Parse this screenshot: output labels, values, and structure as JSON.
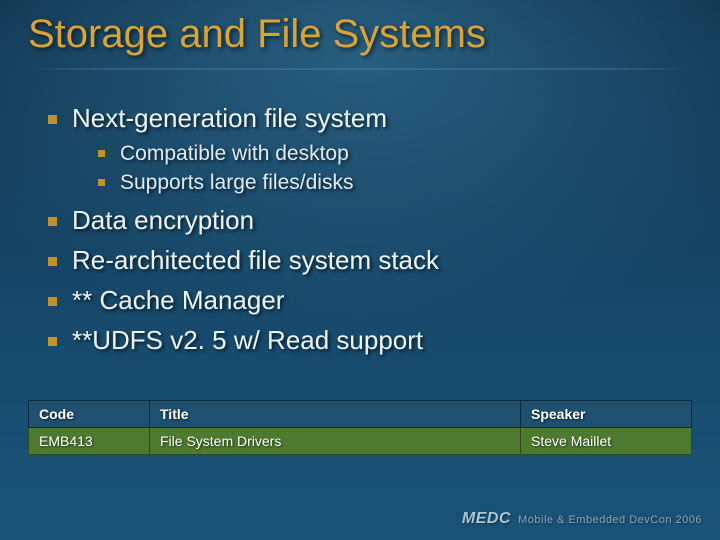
{
  "title": "Storage and File Systems",
  "bullets": {
    "level1": [
      "Next-generation file system",
      "Data encryption",
      "Re-architected file system stack",
      "** Cache Manager",
      "**UDFS v2. 5 w/ Read support"
    ],
    "level2_under_0": [
      "Compatible with desktop",
      "Supports large files/disks"
    ]
  },
  "table": {
    "headers": {
      "code": "Code",
      "title": "Title",
      "speaker": "Speaker"
    },
    "rows": [
      {
        "code": "EMB413",
        "title": "File System Drivers",
        "speaker": "Steve Maillet"
      }
    ]
  },
  "footer": {
    "brand": "MEDC",
    "sub": "Mobile & Embedded DevCon 2006"
  }
}
